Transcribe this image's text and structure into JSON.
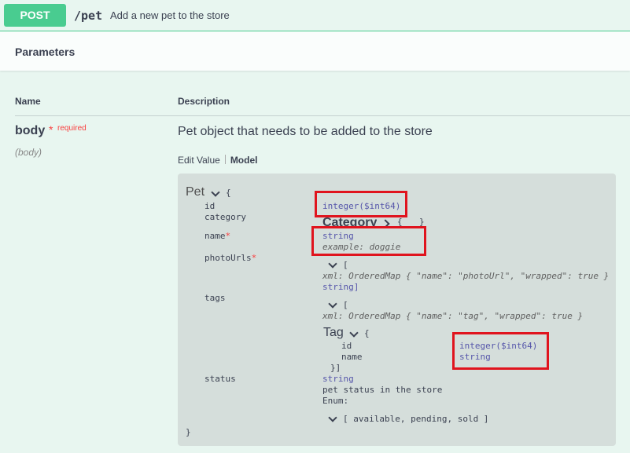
{
  "operation": {
    "method": "POST",
    "path": "/pet",
    "summary": "Add a new pet to the store"
  },
  "parameters_title": "Parameters",
  "columns": {
    "name": "Name",
    "description": "Description"
  },
  "param": {
    "name": "body",
    "required_star": "*",
    "required_label": "required",
    "in": "(body)",
    "description": "Pet object that needs to be added to the store"
  },
  "tabs": {
    "edit": "Edit Value",
    "model": "Model"
  },
  "model": {
    "title": "Pet",
    "open_brace": "{",
    "close_brace": "}",
    "props": {
      "id": {
        "name": "id",
        "type": "integer($int64)"
      },
      "category": {
        "name": "category",
        "ref": "Category",
        "brace": "{",
        "collapsed": "...",
        "close": "}"
      },
      "name": {
        "name": "name",
        "star": "*",
        "type": "string",
        "example": "example: doggie"
      },
      "photoUrls": {
        "name": "photoUrls",
        "star": "*",
        "bracket": "[",
        "xml": "xml: OrderedMap { \"name\": \"photoUrl\", \"wrapped\": true }",
        "item_type": "string]"
      },
      "tags": {
        "name": "tags",
        "bracket": "[",
        "xml": "xml: OrderedMap { \"name\": \"tag\", \"wrapped\": true }"
      },
      "tag": {
        "title": "Tag",
        "brace": "{",
        "id": "id",
        "id_type": "integer($int64)",
        "name": "name",
        "name_type": "string",
        "close": "}]"
      },
      "status": {
        "name": "status",
        "type": "string",
        "desc": "pet status in the store",
        "enum_label": "Enum:",
        "enum_values": "[ available, pending, sold ]"
      }
    }
  },
  "colors": {
    "post": "#49cc90",
    "highlight": "#e0141e",
    "type": "#55a"
  }
}
